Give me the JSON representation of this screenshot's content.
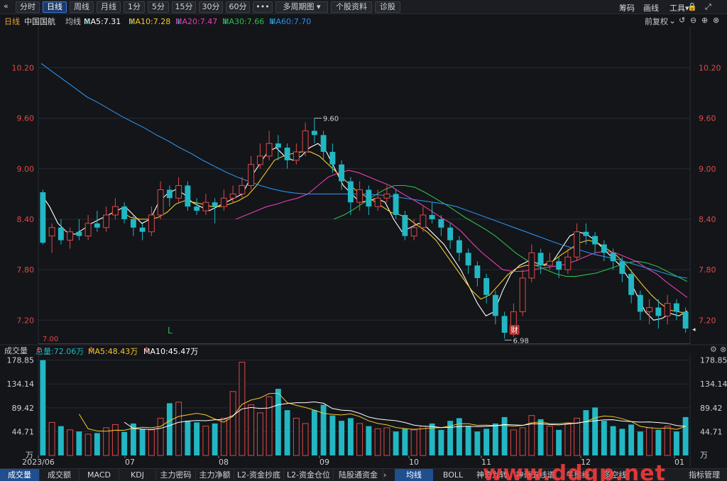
{
  "toolbar": {
    "back_icon": "«",
    "buttons": [
      "分时",
      "日线",
      "周线",
      "月线",
      "1分",
      "5分",
      "15分",
      "30分",
      "60分",
      "•••",
      "多周期图",
      "个股资料",
      "诊股"
    ],
    "active": "日线",
    "right": [
      "筹码",
      "画线",
      "工具"
    ],
    "lock_icon": "lock-icon",
    "expand_icon": "expand-icon"
  },
  "info": {
    "period": "日线",
    "stock": "中国国航",
    "avg_label": "均线",
    "ma5": "MA5:7.31",
    "ma10": "MA10:7.28",
    "ma20": "MA20:7.47",
    "ma30": "MA30:7.66",
    "ma60": "MA60:7.70",
    "restore": "前复权"
  },
  "colors": {
    "up": "#e04848",
    "down": "#22b7c3",
    "ma5": "#ffffff",
    "ma10": "#f4c92b",
    "ma20": "#e83fb1",
    "ma30": "#2fbf4a",
    "ma60": "#2e8ee8",
    "axis_text": "#e04848",
    "grid": "#262a31"
  },
  "volume_info": {
    "label": "成交量",
    "total": "总量:72.06万",
    "ma5": "MA5:48.43万",
    "ma10": "MA10:45.47万"
  },
  "bottom_tabs": [
    "成交量",
    "成交额",
    "MACD",
    "KDJ",
    "主力密码",
    "主力净额",
    "L2-资金抄底",
    "L2-资金仓位",
    "陆股通资金"
  ],
  "bottom_right_tabs": [
    "均线",
    "BOLL",
    "神奇九转",
    "神奇五线谱",
    "牛熊线",
    "多空线",
    "指标管理"
  ],
  "watermark": "www.ddgp.net",
  "chart_data": {
    "type": "candlestick",
    "price_ticks": [
      "10.20",
      "9.60",
      "9.00",
      "8.40",
      "7.80",
      "7.20"
    ],
    "price_ylim": [
      7.0,
      10.6
    ],
    "volume_ticks": [
      "178.85",
      "134.14",
      "89.42",
      "44.71"
    ],
    "volume_unit": "万",
    "volume_ylim": [
      0,
      185
    ],
    "x_labels": [
      "2023/06",
      "07",
      "08",
      "09",
      "10",
      "11",
      "12",
      "01"
    ],
    "high_marker": "9.60",
    "low_marker": "6.98",
    "reference_line": "7.00",
    "annotation_L": "L",
    "annotation_fin": "财",
    "ma_series": [
      {
        "name": "MA5",
        "values": [
          8.7,
          8.55,
          8.35,
          8.25,
          8.22,
          8.28,
          8.35,
          8.4,
          8.45,
          8.5,
          8.55,
          8.45,
          8.35,
          8.4,
          8.6,
          8.7,
          8.75,
          8.7,
          8.6,
          8.55,
          8.5,
          8.55,
          8.6,
          8.65,
          8.7,
          8.9,
          9.05,
          9.2,
          9.25,
          9.15,
          9.1,
          9.15,
          9.25,
          9.3,
          9.2,
          9.0,
          8.8,
          8.7,
          8.6,
          8.62,
          8.65,
          8.6,
          8.4,
          8.25,
          8.3,
          8.35,
          8.3,
          8.2,
          8.1,
          7.95,
          7.8,
          7.6,
          7.4,
          7.25,
          7.3,
          7.55,
          7.75,
          7.85,
          7.9,
          7.88,
          7.85,
          7.9,
          8.05,
          8.2,
          8.25,
          8.22,
          8.15,
          8.05,
          7.95,
          7.85,
          7.7,
          7.5,
          7.3,
          7.2,
          7.22,
          7.28,
          7.25,
          7.31
        ]
      },
      {
        "name": "MA10",
        "values": [
          null,
          null,
          null,
          null,
          null,
          null,
          null,
          null,
          null,
          8.48,
          8.42,
          8.4,
          8.4,
          8.42,
          8.48,
          8.58,
          8.62,
          8.6,
          8.58,
          8.55,
          8.55,
          8.58,
          8.62,
          8.68,
          8.8,
          8.95,
          9.1,
          9.15,
          9.18,
          9.2,
          9.2,
          9.15,
          9.05,
          8.95,
          8.85,
          8.75,
          8.68,
          8.62,
          8.55,
          8.48,
          8.45,
          8.4,
          8.32,
          8.25,
          8.15,
          8.0,
          7.85,
          7.7,
          7.55,
          7.45,
          7.5,
          7.62,
          7.74,
          7.82,
          7.85,
          7.85,
          7.86,
          7.9,
          7.98,
          8.05,
          8.12,
          8.15,
          8.12,
          8.05,
          7.98,
          7.88,
          7.75,
          7.62,
          7.5,
          7.4,
          7.32,
          7.3,
          7.28
        ]
      },
      {
        "name": "MA20",
        "values": [
          null,
          null,
          null,
          null,
          null,
          null,
          null,
          null,
          null,
          null,
          null,
          null,
          null,
          null,
          null,
          null,
          null,
          null,
          null,
          8.4,
          8.45,
          8.5,
          8.55,
          8.58,
          8.62,
          8.65,
          8.7,
          8.8,
          8.9,
          8.95,
          8.98,
          8.95,
          8.9,
          8.85,
          8.8,
          8.72,
          8.65,
          8.58,
          8.5,
          8.42,
          8.35,
          8.25,
          8.12,
          8.0,
          7.9,
          7.8,
          7.78,
          7.78,
          7.8,
          7.82,
          7.84,
          7.86,
          7.9,
          7.95,
          8.0,
          8.02,
          8.0,
          7.95,
          7.9,
          7.82,
          7.75,
          7.65,
          7.56,
          7.47
        ]
      },
      {
        "name": "MA30",
        "values": [
          null,
          null,
          null,
          null,
          null,
          null,
          null,
          null,
          null,
          null,
          null,
          null,
          null,
          null,
          null,
          null,
          null,
          null,
          null,
          null,
          null,
          null,
          null,
          null,
          null,
          null,
          null,
          null,
          null,
          8.4,
          8.45,
          8.52,
          8.6,
          8.68,
          8.75,
          8.8,
          8.8,
          8.78,
          8.72,
          8.65,
          8.58,
          8.5,
          8.42,
          8.35,
          8.28,
          8.2,
          8.1,
          8.0,
          7.92,
          7.85,
          7.8,
          7.75,
          7.72,
          7.72,
          7.74,
          7.76,
          7.8,
          7.84,
          7.88,
          7.9,
          7.88,
          7.84,
          7.78,
          7.72,
          7.66
        ]
      },
      {
        "name": "MA60",
        "values": [
          10.25,
          10.15,
          10.05,
          9.95,
          9.85,
          9.78,
          9.7,
          9.62,
          9.55,
          9.48,
          9.4,
          9.33,
          9.25,
          9.18,
          9.1,
          9.03,
          8.96,
          8.9,
          8.85,
          8.8,
          8.76,
          8.73,
          8.71,
          8.7,
          8.7,
          8.7,
          8.7,
          8.7,
          8.7,
          8.69,
          8.68,
          8.66,
          8.64,
          8.62,
          8.6,
          8.58,
          8.55,
          8.5,
          8.45,
          8.4,
          8.35,
          8.3,
          8.25,
          8.2,
          8.15,
          8.1,
          8.06,
          8.02,
          7.98,
          7.95,
          7.92,
          7.88,
          7.84,
          7.8,
          7.76,
          7.72,
          7.7
        ]
      }
    ],
    "candles": [
      [
        8.72,
        8.12,
        8.75,
        8.1
      ],
      [
        8.2,
        8.3,
        8.35,
        8.0
      ],
      [
        8.3,
        8.15,
        8.4,
        8.1
      ],
      [
        8.15,
        8.25,
        8.3,
        8.05
      ],
      [
        8.25,
        8.2,
        8.4,
        8.15
      ],
      [
        8.2,
        8.35,
        8.45,
        8.15
      ],
      [
        8.35,
        8.3,
        8.5,
        8.25
      ],
      [
        8.3,
        8.45,
        8.55,
        8.25
      ],
      [
        8.45,
        8.55,
        8.65,
        8.4
      ],
      [
        8.55,
        8.4,
        8.6,
        8.35
      ],
      [
        8.4,
        8.3,
        8.45,
        8.2
      ],
      [
        8.3,
        8.25,
        8.35,
        8.15
      ],
      [
        8.25,
        8.45,
        8.55,
        8.2
      ],
      [
        8.45,
        8.75,
        8.85,
        8.4
      ],
      [
        8.75,
        8.65,
        8.8,
        8.55
      ],
      [
        8.65,
        8.8,
        8.9,
        8.6
      ],
      [
        8.8,
        8.55,
        8.85,
        8.5
      ],
      [
        8.55,
        8.5,
        8.65,
        8.45
      ],
      [
        8.5,
        8.6,
        8.7,
        8.45
      ],
      [
        8.6,
        8.55,
        8.65,
        8.35
      ],
      [
        8.55,
        8.65,
        8.75,
        8.5
      ],
      [
        8.65,
        8.7,
        8.8,
        8.6
      ],
      [
        8.7,
        8.8,
        8.9,
        8.65
      ],
      [
        8.8,
        9.05,
        9.15,
        8.75
      ],
      [
        9.05,
        9.15,
        9.3,
        9.0
      ],
      [
        9.15,
        9.3,
        9.45,
        9.1
      ],
      [
        9.3,
        9.25,
        9.4,
        9.1
      ],
      [
        9.25,
        9.1,
        9.3,
        9.0
      ],
      [
        9.1,
        9.2,
        9.3,
        9.05
      ],
      [
        9.2,
        9.45,
        9.55,
        9.15
      ],
      [
        9.45,
        9.4,
        9.6,
        9.3
      ],
      [
        9.4,
        9.2,
        9.45,
        9.1
      ],
      [
        9.2,
        9.05,
        9.3,
        8.95
      ],
      [
        9.05,
        8.85,
        9.1,
        8.75
      ],
      [
        8.85,
        8.6,
        8.9,
        8.45
      ],
      [
        8.6,
        8.75,
        8.85,
        8.5
      ],
      [
        8.75,
        8.55,
        8.8,
        8.45
      ],
      [
        8.55,
        8.65,
        8.75,
        8.5
      ],
      [
        8.65,
        8.7,
        8.8,
        8.6
      ],
      [
        8.7,
        8.45,
        8.75,
        8.4
      ],
      [
        8.45,
        8.2,
        8.5,
        8.15
      ],
      [
        8.2,
        8.3,
        8.4,
        8.15
      ],
      [
        8.3,
        8.45,
        8.55,
        8.25
      ],
      [
        8.45,
        8.4,
        8.6,
        8.35
      ],
      [
        8.4,
        8.3,
        8.45,
        8.2
      ],
      [
        8.3,
        8.15,
        8.35,
        8.05
      ],
      [
        8.15,
        8.0,
        8.2,
        7.9
      ],
      [
        8.0,
        7.85,
        8.05,
        7.75
      ],
      [
        7.85,
        7.7,
        7.9,
        7.6
      ],
      [
        7.7,
        7.5,
        7.75,
        7.4
      ],
      [
        7.5,
        7.25,
        7.55,
        7.15
      ],
      [
        7.25,
        7.05,
        7.3,
        6.98
      ],
      [
        7.05,
        7.3,
        7.4,
        7.0
      ],
      [
        7.3,
        7.7,
        7.8,
        7.25
      ],
      [
        7.7,
        8.0,
        8.1,
        7.65
      ],
      [
        8.0,
        7.85,
        8.05,
        7.75
      ],
      [
        7.85,
        7.9,
        8.0,
        7.8
      ],
      [
        7.9,
        7.8,
        7.95,
        7.7
      ],
      [
        7.8,
        7.95,
        8.05,
        7.75
      ],
      [
        7.95,
        8.25,
        8.35,
        7.9
      ],
      [
        8.25,
        8.2,
        8.35,
        8.1
      ],
      [
        8.2,
        8.1,
        8.25,
        8.0
      ],
      [
        8.1,
        8.0,
        8.15,
        7.9
      ],
      [
        8.0,
        7.9,
        8.05,
        7.8
      ],
      [
        7.9,
        7.75,
        7.95,
        7.65
      ],
      [
        7.75,
        7.5,
        7.8,
        7.4
      ],
      [
        7.5,
        7.3,
        7.55,
        7.2
      ],
      [
        7.3,
        7.35,
        7.45,
        7.15
      ],
      [
        7.35,
        7.25,
        7.45,
        7.1
      ],
      [
        7.25,
        7.4,
        7.5,
        7.15
      ],
      [
        7.4,
        7.3,
        7.45,
        7.2
      ],
      [
        7.3,
        7.1,
        7.35,
        7.05
      ]
    ],
    "volumes": [
      178.85,
      62,
      55,
      48,
      45,
      40,
      42,
      52,
      58,
      44,
      60,
      50,
      48,
      70,
      98,
      100,
      65,
      62,
      55,
      60,
      70,
      120,
      175,
      95,
      80,
      110,
      125,
      85,
      70,
      60,
      85,
      95,
      75,
      65,
      70,
      60,
      55,
      50,
      52,
      45,
      50,
      48,
      55,
      60,
      48,
      65,
      70,
      55,
      45,
      50,
      60,
      72,
      48,
      52,
      75,
      68,
      55,
      48,
      60,
      70,
      85,
      90,
      65,
      55,
      50,
      58,
      45,
      52,
      48,
      55,
      45,
      72.06
    ]
  }
}
